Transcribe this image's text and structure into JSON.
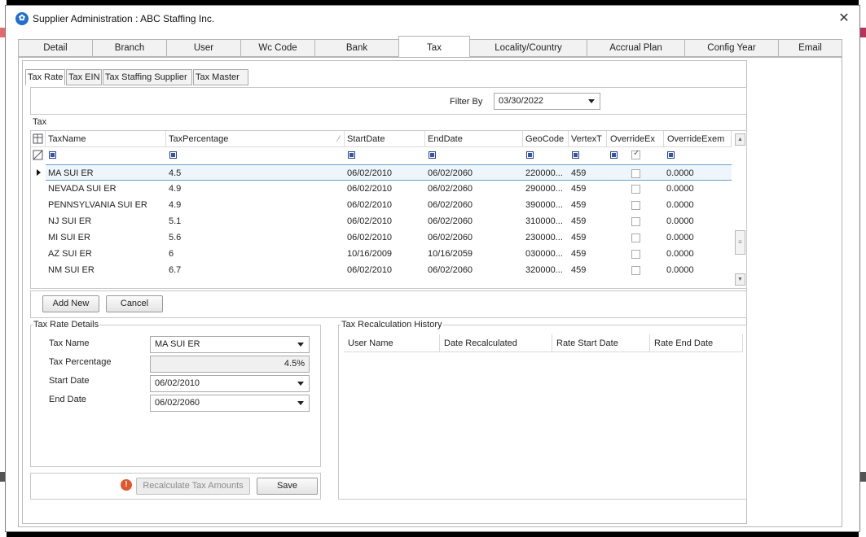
{
  "window": {
    "title": "Supplier Administration : ABC Staffing Inc.",
    "close_label": "✕",
    "app_icon_glyph": "✿"
  },
  "main_tabs": [
    "Detail",
    "Branch",
    "User",
    "Wc Code",
    "Bank",
    "Tax",
    "Locality/Country",
    "Accrual Plan",
    "Config Year",
    "Email"
  ],
  "active_main_tab": "Tax",
  "sub_tabs": [
    "Tax Rate",
    "Tax EIN",
    "Tax Staffing Supplier",
    "Tax Master"
  ],
  "active_sub_tab": "Tax Rate",
  "filter": {
    "label": "Filter By",
    "value": "03/30/2022"
  },
  "tax_group_label": "Tax",
  "grid": {
    "columns": [
      "TaxName",
      "TaxPercentage",
      "StartDate",
      "EndDate",
      "GeoCode",
      "VertexT",
      "OverrideEx",
      "OverrideExem"
    ],
    "sort_indicator": "⁄",
    "selected_row": 0,
    "rows": [
      {
        "name": "MA SUI ER",
        "pct": "4.5",
        "start": "06/02/2010",
        "end": "06/02/2060",
        "geo": "220000...",
        "vertex": "459",
        "override": false,
        "exem": "0.0000"
      },
      {
        "name": "NEVADA SUI ER",
        "pct": "4.9",
        "start": "06/02/2010",
        "end": "06/02/2060",
        "geo": "290000...",
        "vertex": "459",
        "override": false,
        "exem": "0.0000"
      },
      {
        "name": "PENNSYLVANIA SUI ER",
        "pct": "4.9",
        "start": "06/02/2010",
        "end": "06/02/2060",
        "geo": "390000...",
        "vertex": "459",
        "override": false,
        "exem": "0.0000"
      },
      {
        "name": "NJ SUI ER",
        "pct": "5.1",
        "start": "06/02/2010",
        "end": "06/02/2060",
        "geo": "310000...",
        "vertex": "459",
        "override": false,
        "exem": "0.0000"
      },
      {
        "name": "MI SUI ER",
        "pct": "5.6",
        "start": "06/02/2010",
        "end": "06/02/2060",
        "geo": "230000...",
        "vertex": "459",
        "override": false,
        "exem": "0.0000"
      },
      {
        "name": "AZ SUI ER",
        "pct": "6",
        "start": "10/16/2009",
        "end": "10/16/2059",
        "geo": "030000...",
        "vertex": "459",
        "override": false,
        "exem": "0.0000"
      },
      {
        "name": "NM SUI ER",
        "pct": "6.7",
        "start": "06/02/2010",
        "end": "06/02/2060",
        "geo": "320000...",
        "vertex": "459",
        "override": false,
        "exem": "0.0000"
      }
    ]
  },
  "buttons": {
    "add_new": "Add New",
    "cancel": "Cancel",
    "recalculate": "Recalculate Tax Amounts",
    "save": "Save"
  },
  "details": {
    "legend": "Tax Rate Details",
    "tax_name_label": "Tax Name",
    "tax_name_value": "MA SUI ER",
    "tax_pct_label": "Tax Percentage",
    "tax_pct_value": "4.5%",
    "start_label": "Start Date",
    "start_value": "06/02/2010",
    "end_label": "End Date",
    "end_value": "06/02/2060"
  },
  "history": {
    "legend": "Tax Recalculation History",
    "columns": [
      "User Name",
      "Date Recalculated",
      "Rate Start Date",
      "Rate End Date"
    ]
  },
  "colors": {
    "accent": "#1f6fd1",
    "warning": "#e0572e",
    "selection_border": "#6aa0c8"
  }
}
